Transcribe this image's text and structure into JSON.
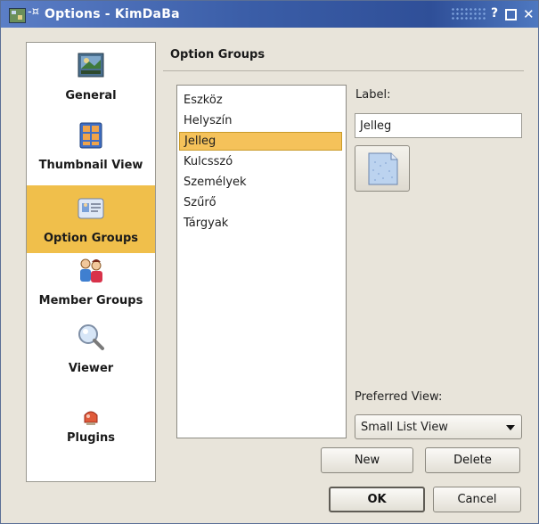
{
  "window": {
    "title": "Options - KimDaBa",
    "pin_glyph": "-¤",
    "help_glyph": "?",
    "close_glyph": "✕"
  },
  "sidebar": {
    "items": [
      {
        "label": "General",
        "icon": "general-image-icon",
        "selected": false
      },
      {
        "label": "Thumbnail View",
        "icon": "thumbnail-grid-icon",
        "selected": false
      },
      {
        "label": "Option Groups",
        "icon": "option-groups-card-icon",
        "selected": true
      },
      {
        "label": "Member Groups",
        "icon": "people-icon",
        "selected": false
      },
      {
        "label": "Viewer",
        "icon": "magnifier-icon",
        "selected": false
      },
      {
        "label": "Plugins",
        "icon": "plugin-icon",
        "selected": false
      }
    ]
  },
  "main": {
    "section_title": "Option Groups",
    "groups": [
      {
        "name": "Eszköz",
        "selected": false
      },
      {
        "name": "Helyszín",
        "selected": false
      },
      {
        "name": "Jelleg",
        "selected": true
      },
      {
        "name": "Kulcsszó",
        "selected": false
      },
      {
        "name": "Személyek",
        "selected": false
      },
      {
        "name": "Szűrő",
        "selected": false
      },
      {
        "name": "Tárgyak",
        "selected": false
      }
    ],
    "label_caption": "Label:",
    "label_value": "Jelleg",
    "preferred_view_caption": "Preferred View:",
    "preferred_view_value": "Small List View",
    "new_label": "New",
    "delete_label": "Delete"
  },
  "footer": {
    "ok_label": "OK",
    "cancel_label": "Cancel"
  },
  "colors": {
    "titlebar": "#3b5ea8",
    "selection": "#f0bf4b",
    "window_bg": "#e8e4da"
  }
}
